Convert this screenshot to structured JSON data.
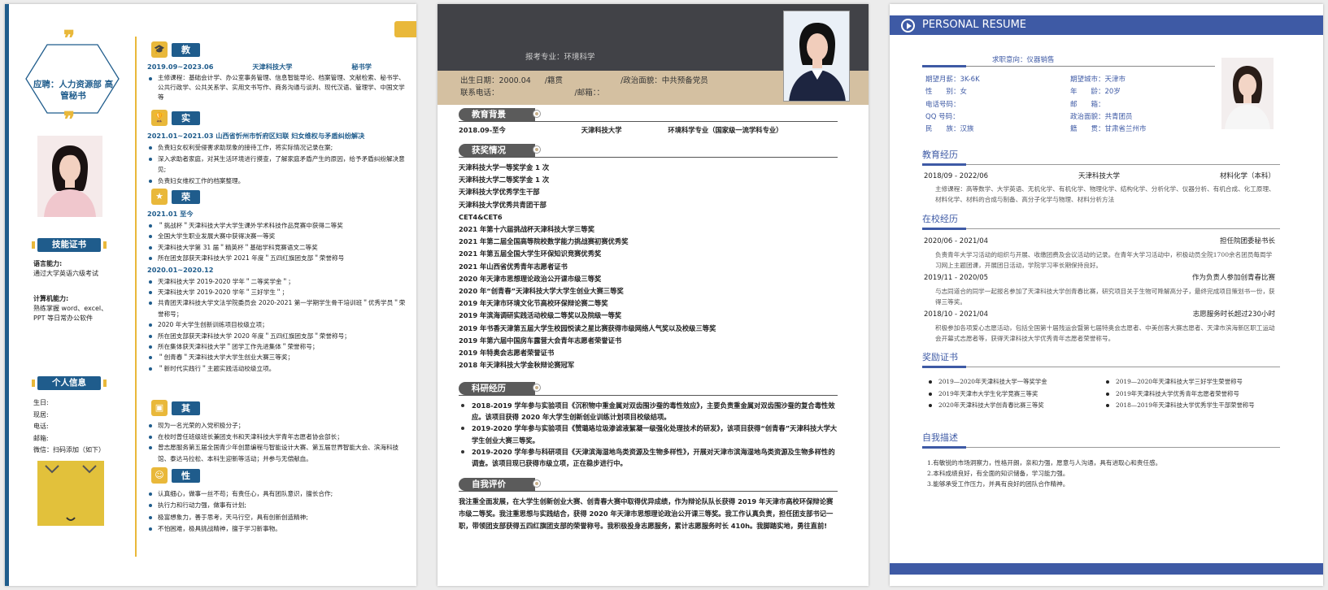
{
  "colors": {
    "navy": "#1f5c8c",
    "gold": "#e9b83a",
    "dark": "#414247",
    "tan": "#d4c0a1",
    "blue": "#3e5aa5"
  },
  "resume1": {
    "objective": "应聘：人力资源部 高管秘书",
    "sections": {
      "edu": "教育背景",
      "intern": "实习经历",
      "honor": "荣誉奖项",
      "other": "其它经历",
      "trait": "性格特征",
      "skills": "技能证书",
      "personal": "个人信息"
    },
    "skills": [
      {
        "title": "语言能力:",
        "text": "通过大学英语六级考试"
      },
      {
        "title": "计算机能力:",
        "text": "熟练掌握 word、excel、PPT 等日常办公软件"
      }
    ],
    "personal": [
      "生日:",
      "现居:",
      "电话:",
      "邮箱:",
      "微信：扫码添加（如下）"
    ],
    "edu": {
      "date": "2019.09~2023.06",
      "school": "天津科技大学",
      "major": "秘书学",
      "courses": "主修课程：基础会计学、办公室事务管理、信息智能导论、档案管理、文献检索、秘书学、公共行政学、公共关系学、实用文书写作、商务沟通与谈判、现代汉语、管理学、中国文学等"
    },
    "intern": {
      "head": "2021.01~2021.03    山西省忻州市忻府区妇联    妇女维权与矛盾纠纷解决",
      "items": [
        "负责妇女权利受侵害求助现象的接待工作，将实际情况记录在案;",
        "深入求助者家庭，对其生活环境进行摸查，了解家庭矛盾产生的原因，给予矛盾纠纷解决意见;",
        "负责妇女维权工作的档案整理。"
      ]
    },
    "honor": {
      "g1": "2021.01 至今",
      "items1": [
        "＂挑战杯＂天津科技大学大学生课外学术科技作品竞赛中获得二等奖",
        "全国大学生职业发展大赛中获得决赛一等奖",
        "天津科技大学第 31 届＂精英杯＂基础学科竞赛语文二等奖",
        "所在团支部获天津科技大学 2021 年度＂五四红旗团支部＂荣誉称号"
      ],
      "g2": "2020.01~2020.12",
      "items2": [
        "天津科技大学 2019-2020 学年＂二等奖学金＂；",
        "天津科技大学 2019-2020 学年＂三好学生＂；",
        "共青团天津科技大学文法学院委员会 2020-2021 第一学期学生骨干培训班＂优秀学员＂荣誉称号；",
        "2020 年大学生创新训练项目校级立项；",
        "所在团支部获天津科技大学 2020 年度＂五四红旗团支部＂荣誉称号；",
        "所在集体获天津科技大学＂团学工作先进集体＂荣誉称号；",
        "＂创青春＂天津科技大学大学生创业大赛三等奖；",
        "＂新时代实践行＂主题实践活动校级立项。"
      ]
    },
    "other": [
      "现为一名光荣的入党积极分子；",
      "在校时曾任班级班长兼团支书和天津科技大学青年志愿者协会部长；",
      "曾志愿服务第五届全国青少年创意编程与智能设计大赛、第五届世界智能大会、滨海科技馆、泰达马拉松、本科生迎新等活动；并参与无偿献血。"
    ],
    "trait": [
      "认真细心，做事一丝不苟；有责任心，具有团队意识，擅长合作;",
      "执行力和行动力强，做事有计划;",
      "极富想象力，善于思考，天马行空，具有创新创造精神;",
      "不怕困难，极具挑战精神，擅于学习新事物。"
    ]
  },
  "resume2": {
    "major": "报考专业：环境科学",
    "row1": {
      "birth": "出生日期：2000.04",
      "origin": "/籍贯",
      "politics": "/政治面貌：中共预备党员"
    },
    "row2": {
      "phone": "联系电话：",
      "email": "/邮箱：："
    },
    "sections": {
      "edu": "教育背景",
      "award": "获奖情况",
      "research": "科研经历",
      "self": "自我评价"
    },
    "edu": {
      "date": "2018.09-至今",
      "school": "天津科技大学",
      "major": "环境科学专业（国家级一流学科专业）"
    },
    "awards": [
      "天津科技大学一等奖学金 1 次",
      "天津科技大学二等奖学金 1 次",
      "天津科技大学优秀学生干部",
      "天津科技大学优秀共青团干部",
      "CET4&CET6",
      "2021 年第十六届挑战杯天津科技大学三等奖",
      "2021 年第二届全国高等院校数学能力挑战赛初赛优秀奖",
      "2021 年第五届全国大学生环保知识竞赛优秀奖",
      "2021 年山西省优秀青年志愿者证书",
      "2020 年天津市思想理论政治公开课市级三等奖",
      "2020 年“创青春”天津科技大学大学生创业大赛三等奖",
      "2019 年天津市环境文化节高校环保辩论赛二等奖",
      "2019 年滨海调研实践活动校级二等奖以及院级一等奖",
      "2019 年书香天津第五届大学生校园悦读之星比赛获得市级网络人气奖以及校级三等奖",
      "2019 年第六届中国房车露营大会青年志愿者荣誉证书",
      "2019 年特奥会志愿者荣誉证书",
      "2018 年天津科技大学金秋辩论赛冠军"
    ],
    "research": [
      "2018-2019 学年参与实验项目《沉积物中重金属对双齿围沙蚕的毒性效应》，主要负责重金属对双齿围沙蚕的复合毒性效应。该项目获得 2020 年大学生创新创业训练计划项目校级结项。",
      "2019-2020 学年参与实验项目《赞璐珞垃圾渗滤液絮凝一级强化处理技术的研发》，该项目获得“创青春”天津科技大学大学生创业大赛三等奖。",
      "2019-2020 学年参与科研项目《天津滨海湿地鸟类资源及生物多样性》，开展对天津市滨海湿地鸟类资源及生物多样性的调查。该项目现已获得市级立项，正在稳步进行中。"
    ],
    "self": "我注重全面发展，在大学生创新创业大赛、创青春大赛中取得优异成绩，作为辩论队队长获得 2019 年天津市高校环保辩论赛市级二等奖。我注重思想与实践结合，获得 2020 年天津市思想理论政治公开课三等奖。我工作认真负责，担任团支部书记一职，带领团支部获得五四红旗团支部的荣誉称号。我积极投身志愿服务，累计志愿服务时长 410h。我脚踏实地，勇往直前!"
  },
  "resume3": {
    "title": "PERSONAL RESUME",
    "objective": "求职意向：仪器销售",
    "info_left": [
      "期望月薪：3K-6K",
      "性　　别：女",
      "电话号码：",
      "QQ 号码：",
      "民　　族：汉族"
    ],
    "info_right": [
      "期望城市：天津市",
      "年　　龄：20岁",
      "邮　　箱：",
      "政治面貌：共青团员",
      "籍　　贯：甘肃省兰州市"
    ],
    "sections": {
      "edu": "教育经历",
      "campus": "在校经历",
      "award": "奖励证书",
      "self": "自我描述"
    },
    "edu": {
      "date": "2018/09 - 2022/06",
      "school": "天津科技大学",
      "major": "材料化学（本科）",
      "courses": "主修课程：高等数学、大学英语、无机化学、有机化学、物理化学、结构化学、分析化学、仪器分析、有机合成、化工原理、材料化学、材料的合成与制备、高分子化学与物理、材料分析方法"
    },
    "campus": [
      {
        "date": "2020/06 - 2021/04",
        "role": "担任院团委秘书长",
        "desc": "负责青年大学习活动的组织与开展、收缴团费及会议活动的记录。在青年大学习活动中，积极动员全院1700余名团员每周学习网上主题团课，开展团日活动，学院学习率长期保持良好。"
      },
      {
        "date": "2019/11 - 2020/05",
        "role": "作为负责人参加创青春比赛",
        "desc": "与志同道合的同学一起报名参加了天津科技大学创青春比赛，研究项目关于生物可降解高分子，最终完成项目策划书一份，获得三等奖。"
      },
      {
        "date": "2018/10 - 2021/04",
        "role": "志愿服务时长超过230小时",
        "desc": "积极参加各项爱心志愿活动，包括全国第十届残运会暨第七届特奥会志愿者、中美创客大赛志愿者、天津市滨海新区职工运动会开幕式志愿者等，获得天津科技大学优秀青年志愿者荣誉称号。"
      }
    ],
    "awards_left": [
      "2019—2020年天津科技大学一等奖学金",
      "2019年天津市大学生化学竞赛三等奖",
      "2020年天津科技大学创青春比赛三等奖"
    ],
    "awards_right": [
      "2019—2020年天津科技大学三好学生荣誉称号",
      "2019年天津科技大学优秀青年志愿者荣誉称号",
      "2018—2019年天津科技大学优秀学生干部荣誉称号"
    ],
    "self": [
      "1.有敏锐的市场洞察力，性格开朗，亲和力强，愿意与人沟通，具有进取心和责任感。",
      "2.本科成绩良好，有全面的知识储备，学习能力强。",
      "3.能够承受工作压力，并具有良好的团队合作精神。"
    ]
  }
}
